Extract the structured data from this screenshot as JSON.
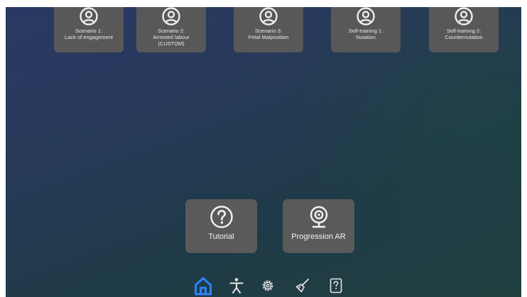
{
  "scenarios": [
    {
      "label": "Scenario 1:\nLack of engagement",
      "icon": "user-circle-icon"
    },
    {
      "label": "Scenario 2:\nArrested labour\n(CUSTOM)",
      "icon": "user-circle-icon"
    },
    {
      "label": "Scenario 3:\nFetal Malposition",
      "icon": "user-circle-icon"
    },
    {
      "label": "Self-training 1:\nNutation",
      "icon": "user-circle-icon"
    },
    {
      "label": "Self-training 2:\nCounternutation",
      "icon": "user-circle-icon"
    }
  ],
  "actions": {
    "tutorial": {
      "label": "Tutorial",
      "icon": "question-circle-icon"
    },
    "progression": {
      "label": "Progression AR",
      "icon": "webcam-icon"
    }
  },
  "nav": {
    "items": [
      "home-icon",
      "person-icon",
      "gear-icon",
      "brush-icon",
      "help-document-icon"
    ],
    "active": "home-icon",
    "active_color": "#2a84ff"
  },
  "colors": {
    "tile": "#585858",
    "icon": "#ececec"
  }
}
